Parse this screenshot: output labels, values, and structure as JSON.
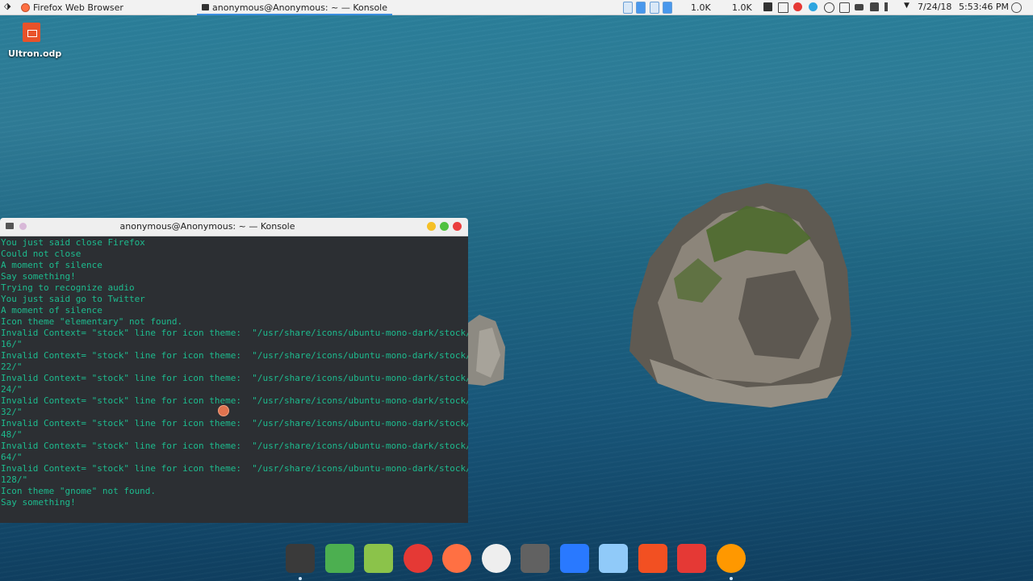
{
  "topbar": {
    "tasks": [
      {
        "label": "Firefox Web Browser",
        "icon": "firefox-icon",
        "active": false
      },
      {
        "label": "anonymous@Anonymous: ~ — Konsole",
        "icon": "konsole-icon",
        "active": true
      }
    ],
    "net_down": "1.0K",
    "net_up": "1.0K",
    "date": "7/24/18",
    "time": "5:53:46 PM"
  },
  "desktop": {
    "icons": [
      {
        "label": "Ultron.odp",
        "icon": "presentation-file-icon"
      }
    ]
  },
  "konsole": {
    "title": "anonymous@Anonymous: ~ — Konsole",
    "lines": [
      "You just said close Firefox",
      "Could not close",
      "A moment of silence",
      "Say something!",
      "Trying to recognize audio",
      "You just said go to Twitter",
      "A moment of silence",
      "Icon theme \"elementary\" not found.",
      "Invalid Context= \"stock\" line for icon theme:  \"/usr/share/icons/ubuntu-mono-dark/stock/",
      "16/\"",
      "Invalid Context= \"stock\" line for icon theme:  \"/usr/share/icons/ubuntu-mono-dark/stock/",
      "22/\"",
      "Invalid Context= \"stock\" line for icon theme:  \"/usr/share/icons/ubuntu-mono-dark/stock/",
      "24/\"",
      "Invalid Context= \"stock\" line for icon theme:  \"/usr/share/icons/ubuntu-mono-dark/stock/",
      "32/\"",
      "Invalid Context= \"stock\" line for icon theme:  \"/usr/share/icons/ubuntu-mono-dark/stock/",
      "48/\"",
      "Invalid Context= \"stock\" line for icon theme:  \"/usr/share/icons/ubuntu-mono-dark/stock/",
      "64/\"",
      "Invalid Context= \"stock\" line for icon theme:  \"/usr/share/icons/ubuntu-mono-dark/stock/",
      "128/\"",
      "Icon theme \"gnome\" not found.",
      "Say something!"
    ],
    "text_color": "#1dbb8e",
    "bg_color": "#2c2f33"
  },
  "dock": {
    "items": [
      {
        "name": "terminal-icon",
        "color": "#3a3a3a",
        "running": true
      },
      {
        "name": "files-icon",
        "color": "#4caf50",
        "running": false
      },
      {
        "name": "archive-manager-icon",
        "color": "#8bc34a",
        "running": false
      },
      {
        "name": "chrome-icon",
        "color": "#e53935",
        "running": false
      },
      {
        "name": "firefox-icon",
        "color": "#ff7043",
        "running": false
      },
      {
        "name": "writer-icon",
        "color": "#eeeeee",
        "running": false
      },
      {
        "name": "calculator-icon",
        "color": "#616161",
        "running": false
      },
      {
        "name": "vscode-icon",
        "color": "#2979ff",
        "running": false
      },
      {
        "name": "virtualbox-icon",
        "color": "#90caf9",
        "running": false
      },
      {
        "name": "microsoft-icon",
        "color": "#f25022",
        "running": false
      },
      {
        "name": "screen-recorder-icon",
        "color": "#e53935",
        "running": false
      },
      {
        "name": "ubuntu-settings-icon",
        "color": "#ff9800",
        "running": true
      }
    ]
  }
}
